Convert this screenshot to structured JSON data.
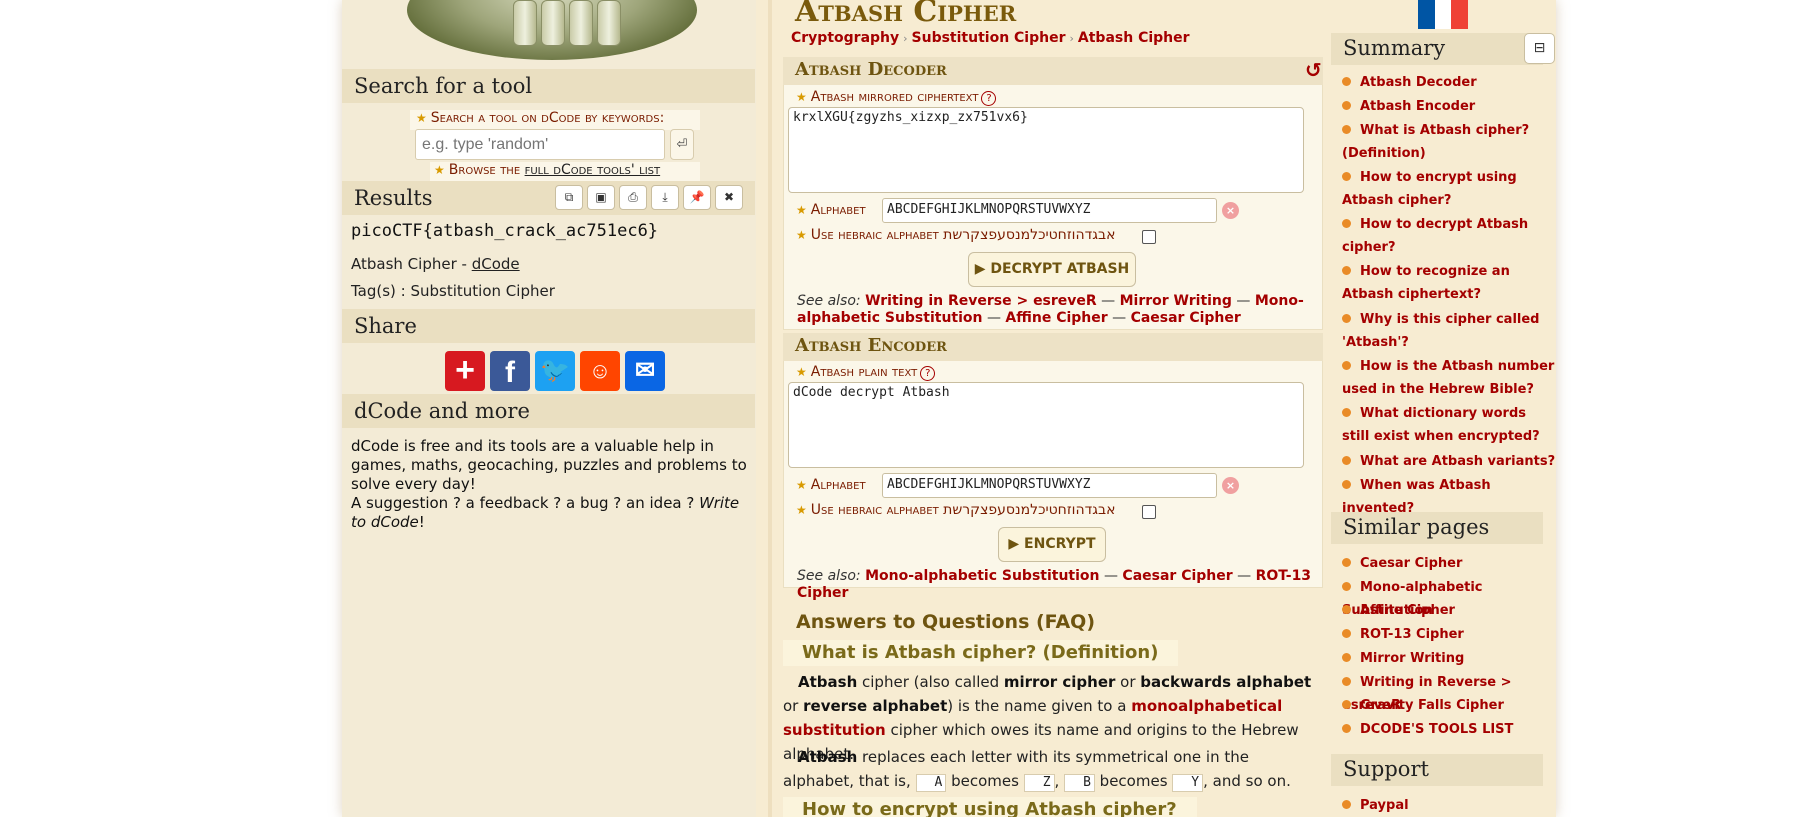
{
  "left": {
    "search_heading": "Search for a tool",
    "search_label": "Search a tool on dCode by keywords:",
    "search_placeholder": "e.g. type 'random'",
    "search_button_icon": "enter-icon",
    "browse_prefix": "Browse the ",
    "browse_link": "full dCode tools' list",
    "results_heading": "Results",
    "result_tools": [
      "copy-icon",
      "screenshot-icon",
      "print-icon",
      "download-icon",
      "pin-icon",
      "close-icon"
    ],
    "result_value": "picoCTF{atbash_crack_ac751ec6}",
    "result_source_prefix": "Atbash Cipher - ",
    "result_source_link": "dCode",
    "result_tags": "Tag(s) : Substitution Cipher",
    "share_heading": "Share",
    "share_buttons": [
      {
        "name": "addthis",
        "icon": "plus-icon",
        "color": "#d71920"
      },
      {
        "name": "facebook",
        "icon": "facebook-icon",
        "color": "#3b5998"
      },
      {
        "name": "twitter",
        "icon": "twitter-icon",
        "color": "#1da1f2"
      },
      {
        "name": "reddit",
        "icon": "reddit-icon",
        "color": "#ff4500"
      },
      {
        "name": "email",
        "icon": "mail-icon",
        "color": "#0a66e4"
      }
    ],
    "more_heading": "dCode and more",
    "more_text": "dCode is free and its tools are a valuable help in games, maths, geocaching, puzzles and problems to solve every day!",
    "more_suggestion": "A suggestion ? a feedback ? a bug ? an idea ? ",
    "more_link": "Write to dCode",
    "more_end": "!"
  },
  "center": {
    "title": "Atbash Cipher",
    "breadcrumbs": [
      "Cryptography",
      "Substitution Cipher",
      "Atbash Cipher"
    ],
    "decoder": {
      "heading": "Atbash Decoder",
      "reset_icon": "refresh-icon",
      "text_label": "Atbash mirrored ciphertext",
      "text_value": "krxlXGU{zgyzhs_xizxp_zx751vx6}",
      "alphabet_label": "Alphabet",
      "alphabet_value": "ABCDEFGHIJKLMNOPQRSTUVWXYZ",
      "hebrew_label": "Use hebraic alphabet אבגדהוזחטיכלמנסעפצקרשת",
      "button": "▶ DECRYPT ATBASH",
      "see_also_label": "See also:",
      "see_also": [
        "Writing in Reverse > esreveR",
        "Mirror Writing",
        "Mono-alphabetic Substitution",
        "Affine Cipher",
        "Caesar Cipher"
      ]
    },
    "encoder": {
      "heading": "Atbash Encoder",
      "text_label": "Atbash plain text",
      "text_value": "dCode decrypt Atbash",
      "alphabet_label": "Alphabet",
      "alphabet_value": "ABCDEFGHIJKLMNOPQRSTUVWXYZ",
      "hebrew_label": "Use hebraic alphabet אבגדהוזחטיכלמנסעפצקרשת",
      "button": "▶ ENCRYPT",
      "see_also_label": "See also:",
      "see_also": [
        "Mono-alphabetic Substitution",
        "Caesar Cipher",
        "ROT-13 Cipher"
      ]
    },
    "faq": {
      "title": "Answers to Questions (FAQ)",
      "q1": "What is Atbash cipher? (Definition)",
      "a1_b1": "Atbash",
      "a1_t1": " cipher (also called ",
      "a1_b2": "mirror cipher",
      "a1_t2": " or ",
      "a1_b3": "backwards alphabet",
      "a1_t3": " or ",
      "a1_b4": "reverse alphabet",
      "a1_t4": ") is the name given to a ",
      "a1_link": "monoalphabetical substitution",
      "a1_t5": " cipher which owes its name and origins to the Hebrew alphabet.",
      "a2_b1": "Atbash",
      "a2_t1": " replaces each letter with its symmetrical one in the alphabet, that is, ",
      "chip_a": "A",
      "a2_t2": " becomes ",
      "chip_z": "Z",
      "a2_t3": ", ",
      "chip_b": "B",
      "a2_t4": " becomes ",
      "chip_y": "Y",
      "a2_t5": ", and so on.",
      "q2": "How to encrypt using Atbash cipher?"
    }
  },
  "right": {
    "flag_colors": [
      "#0055a4",
      "#ffffff",
      "#ef4135"
    ],
    "summary_heading": "Summary",
    "collapse_icon": "collapse-icon",
    "summary_items": [
      "Atbash Decoder",
      "Atbash Encoder",
      "What is Atbash cipher? (Definition)",
      "How to encrypt using Atbash cipher?",
      "How to decrypt Atbash cipher?",
      "How to recognize an Atbash ciphertext?",
      "Why is this cipher called 'Atbash'?",
      "How is the Atbash number used in the Hebrew Bible?",
      "What dictionary words still exist when encrypted?",
      "What are Atbash variants?",
      "When was Atbash invented?"
    ],
    "similar_heading": "Similar pages",
    "similar_items": [
      "Caesar Cipher",
      "Mono-alphabetic Substitution",
      "Affine Cipher",
      "ROT-13 Cipher",
      "Mirror Writing",
      "Writing in Reverse > esreveR",
      "Gravity Falls Cipher",
      "DCODE'S TOOLS LIST"
    ],
    "support_heading": "Support",
    "support_items": [
      "Paypal"
    ]
  }
}
